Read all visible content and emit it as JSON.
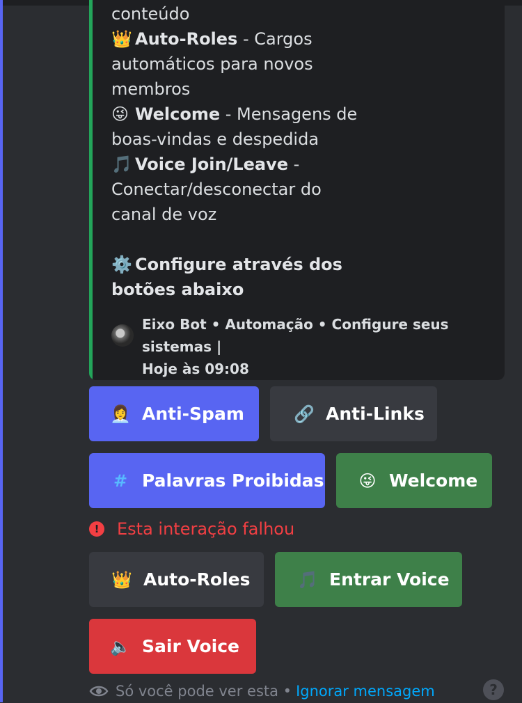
{
  "embed": {
    "lines": [
      {
        "type": "text",
        "text": "conteúdo"
      },
      {
        "type": "feature",
        "icon": "👑",
        "bold": "Auto-Roles",
        "rest": " - Cargos"
      },
      {
        "type": "text",
        "text": "automáticos para novos"
      },
      {
        "type": "text",
        "text": "membros"
      },
      {
        "type": "feature",
        "icon": "😜",
        "bold": "Welcome",
        "rest": " - Mensagens de"
      },
      {
        "type": "text",
        "text": "boas-vindas e despedida"
      },
      {
        "type": "feature",
        "icon": "🎵",
        "bold": "Voice Join/Leave",
        "rest": " -"
      },
      {
        "type": "text",
        "text": "Conectar/desconectar do"
      },
      {
        "type": "text",
        "text": "canal de voz"
      },
      {
        "type": "spacer",
        "text": ""
      },
      {
        "type": "feature",
        "icon": "⚙️",
        "bold": "Configure através dos",
        "rest": ""
      },
      {
        "type": "boldline",
        "text": "botões abaixo"
      }
    ],
    "footer": {
      "line1": "Eixo Bot • Automação • Configure seus sistemas |",
      "line2": "Hoje às 09:08"
    },
    "accent_color": "#23a55a"
  },
  "buttons": {
    "anti_spam": {
      "icon": "👩‍💼",
      "label": "Anti-Spam"
    },
    "anti_links": {
      "icon": "🔗",
      "label": "Anti-Links"
    },
    "palavras": {
      "icon": "#",
      "label": "Palavras Proibidas"
    },
    "welcome": {
      "icon": "😜",
      "label": "Welcome"
    },
    "auto_roles": {
      "icon": "👑",
      "label": "Auto-Roles"
    },
    "entrar_voice": {
      "icon": "🎵",
      "label": "Entrar Voice"
    },
    "sair_voice": {
      "icon": "🔈",
      "label": "Sair Voice"
    }
  },
  "error": {
    "icon": "!",
    "text": "Esta interação falhou"
  },
  "ephemeral": {
    "text": "Só você pode ver esta •",
    "dismiss": "Ignorar mensagem"
  },
  "help": {
    "icon": "?"
  },
  "colors": {
    "blurple": "#5865f2",
    "secondary": "#383a40",
    "success": "#3e8049",
    "danger": "#da373c",
    "link": "#00a8fc"
  }
}
